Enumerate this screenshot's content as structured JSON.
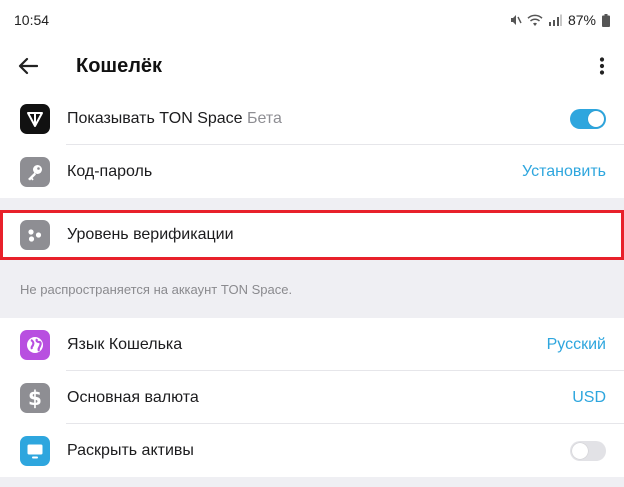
{
  "status": {
    "time": "10:54",
    "battery": "87%"
  },
  "header": {
    "title": "Кошелёк"
  },
  "group1": {
    "ton_space": {
      "label": "Показывать TON Space",
      "badge": "Бета",
      "toggle_on": true
    },
    "passcode": {
      "label": "Код-пароль",
      "value": "Установить"
    }
  },
  "verification": {
    "label": "Уровень верификации",
    "note": "Не распространяется на аккаунт TON Space."
  },
  "group2": {
    "language": {
      "label": "Язык Кошелька",
      "value": "Русский"
    },
    "currency": {
      "label": "Основная валюта",
      "value": "USD"
    },
    "reveal": {
      "label": "Раскрыть активы",
      "toggle_on": false
    }
  },
  "colors": {
    "accent": "#2ea6de",
    "highlight_border": "#e8202a",
    "language_icon": "#b84fe0",
    "reveal_icon": "#2ea6de",
    "ton_icon": "#111111",
    "gray_icon": "#8e8e93"
  }
}
